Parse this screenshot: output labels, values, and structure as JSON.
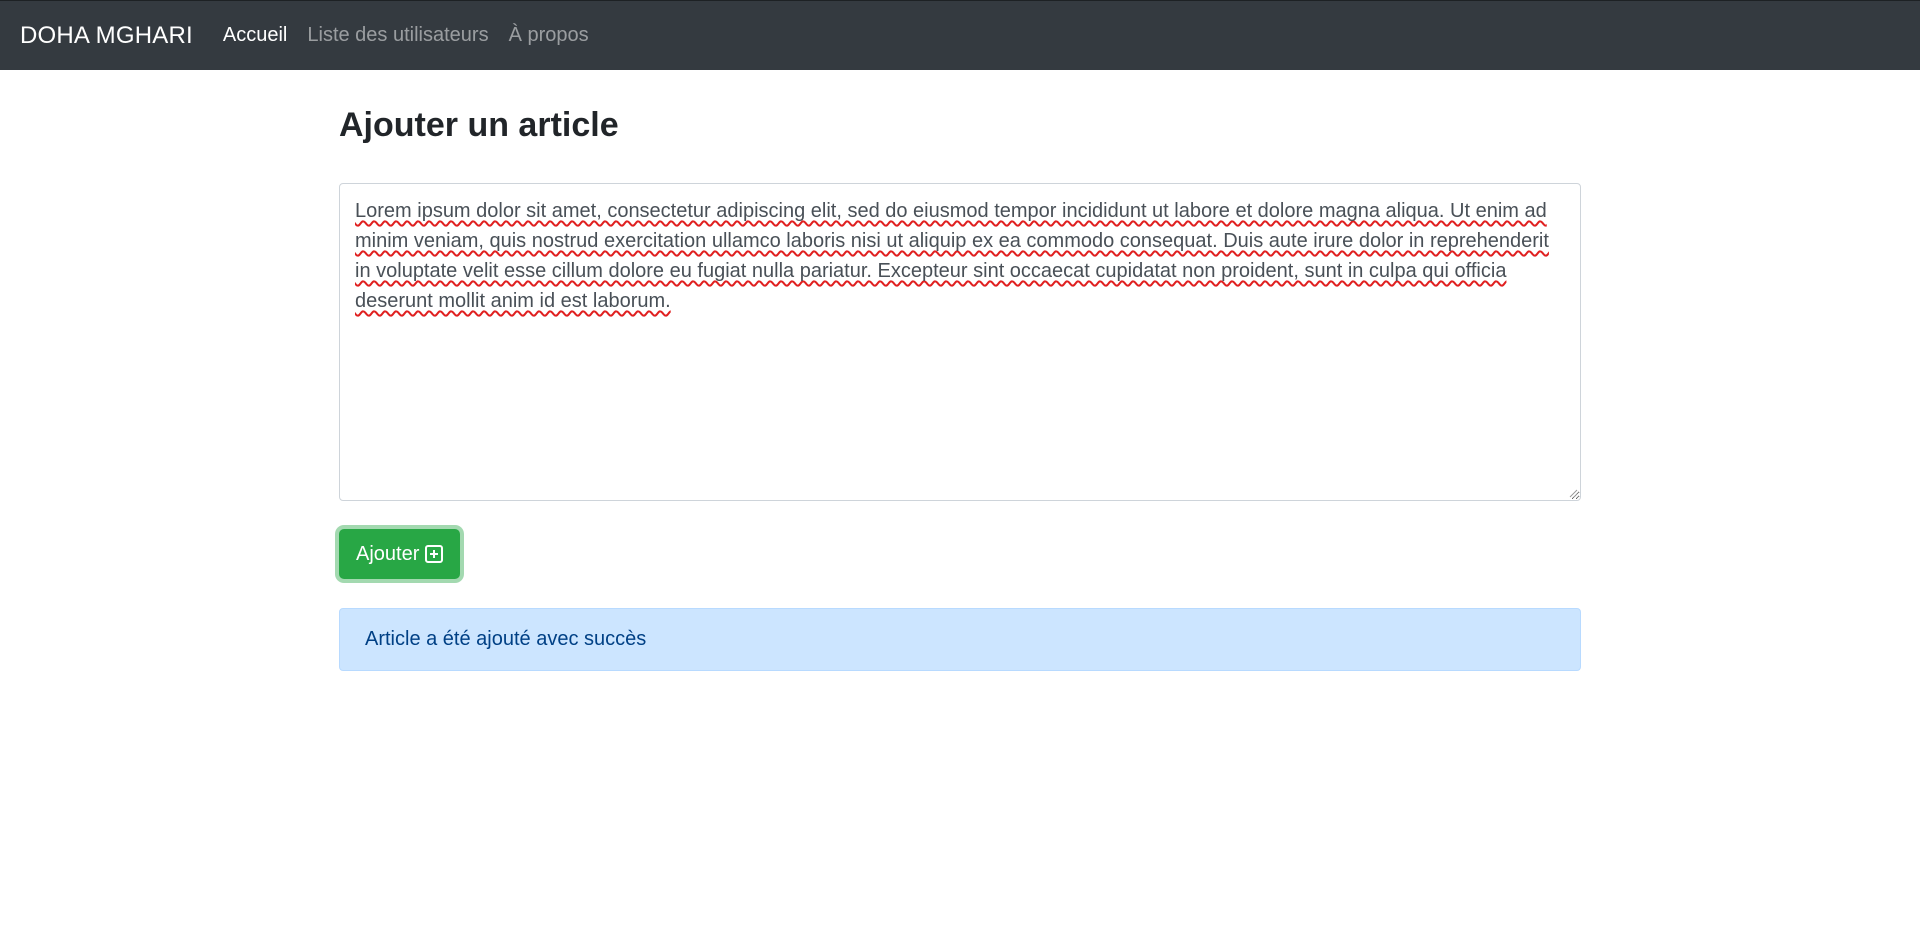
{
  "navbar": {
    "brand": "DOHA MGHARI",
    "links": [
      {
        "label": "Accueil",
        "active": true
      },
      {
        "label": "Liste des utilisateurs",
        "active": false
      },
      {
        "label": "À propos",
        "active": false
      }
    ]
  },
  "page": {
    "title": "Ajouter un article"
  },
  "form": {
    "textarea_value": "Lorem ipsum dolor sit amet, consectetur adipiscing elit, sed do eiusmod tempor incididunt ut labore et dolore magna aliqua. Ut enim ad minim veniam, quis nostrud exercitation ullamco laboris nisi ut aliquip ex ea commodo consequat. Duis aute irure dolor in reprehenderit in voluptate velit esse cillum dolore eu fugiat nulla pariatur. Excepteur sint occaecat cupidatat non proident, sunt in culpa qui officia deserunt mollit anim id est laborum.",
    "submit_label": "Ajouter",
    "submit_icon": "plus-square-icon"
  },
  "alert": {
    "message": "Article a été ajouté avec succès"
  },
  "colors": {
    "navbar_bg": "#343a40",
    "button_bg": "#28a745",
    "alert_bg": "#cce5ff",
    "alert_text": "#004085"
  }
}
